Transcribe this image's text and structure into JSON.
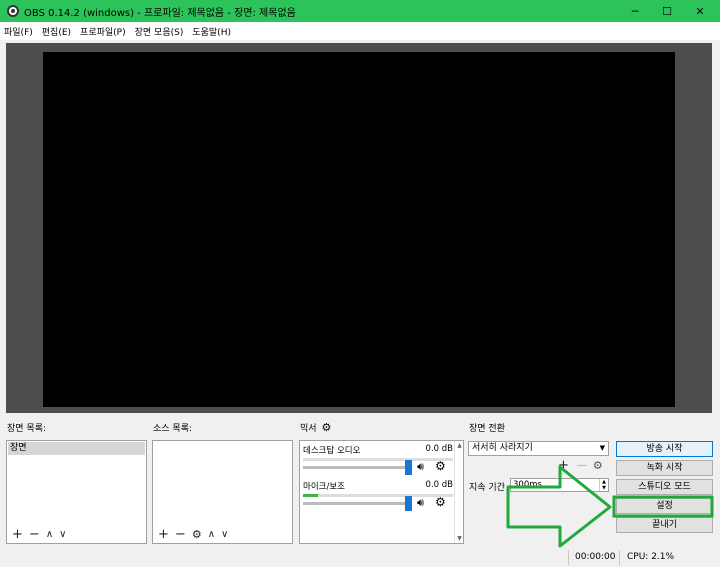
{
  "window": {
    "title": "OBS 0.14.2 (windows) - 프로파일: 제목없음 - 장면: 제목없음",
    "minimize": "─",
    "maximize": "☐",
    "close": "✕"
  },
  "menu": [
    "파일(F)",
    "편집(E)",
    "프로파일(P)",
    "장면 모음(S)",
    "도움말(H)"
  ],
  "scenes": {
    "title": "장면 목록:",
    "items": [
      "장면"
    ],
    "icons": {
      "add": "+",
      "remove": "−",
      "up": "∧",
      "down": "∨"
    }
  },
  "sources": {
    "title": "소스 목록:",
    "icons": {
      "add": "+",
      "remove": "−",
      "settings": "⚙",
      "up": "∧",
      "down": "∨"
    }
  },
  "mixer": {
    "title": "믹서",
    "gear": "⚙",
    "channels": [
      {
        "name": "데스크탑 오디오",
        "db": "0.0 dB",
        "level": 0.0,
        "volume": 1.0
      },
      {
        "name": "마이크/보조",
        "db": "0.0 dB",
        "level": 0.1,
        "volume": 1.0
      }
    ]
  },
  "transitions": {
    "title": "장면 전환",
    "selected": "서서히 사라지기",
    "icons": {
      "add": "+",
      "remove": "—",
      "settings": "⚙"
    },
    "duration_label": "지속 기간",
    "duration_value": "300ms"
  },
  "controls": {
    "start_streaming": "방송 시작",
    "start_recording": "녹화 시작",
    "studio_mode": "스튜디오 모드",
    "settings": "설정",
    "exit": "끝내기"
  },
  "status": {
    "time": "00:00:00",
    "cpu": "CPU: 2.1%"
  },
  "colors": {
    "titlebar": "#2cc45a",
    "annotation": "#1faa3a",
    "focus": "#0078d7",
    "meter": "#3cb54a",
    "volume_handle": "#1976d2"
  }
}
